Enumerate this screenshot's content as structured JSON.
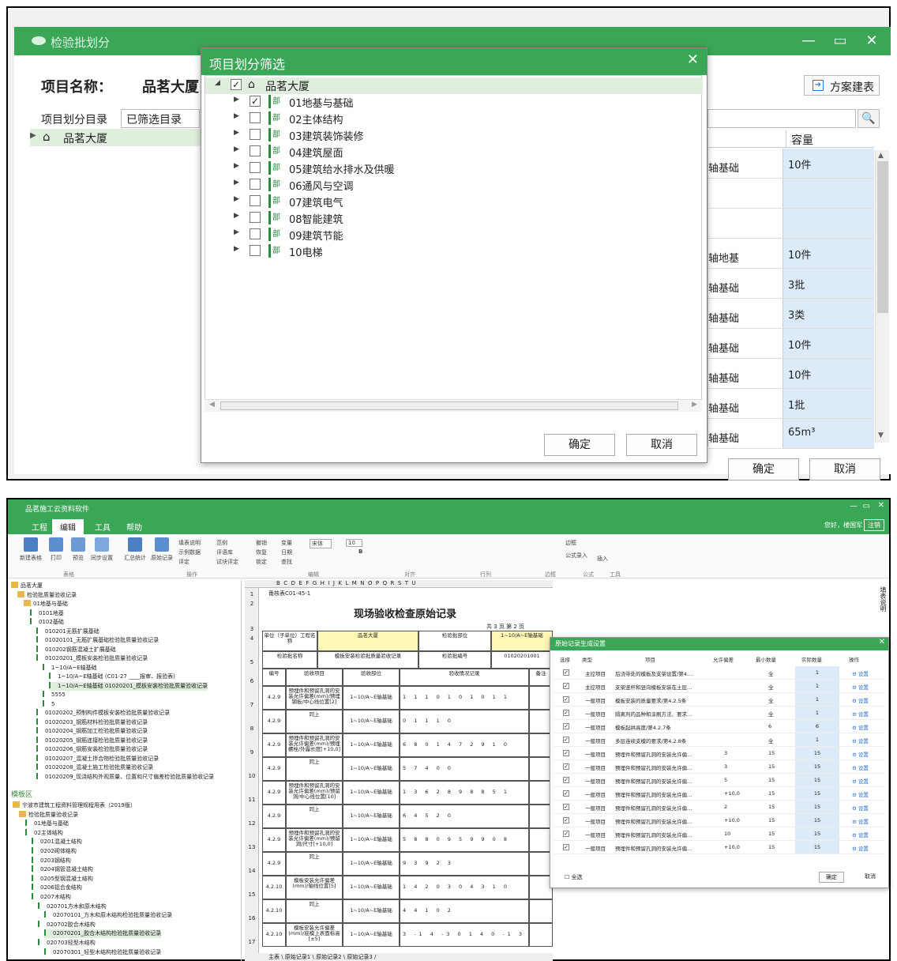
{
  "top_window": {
    "title": "检验批划分",
    "project_label": "项目名称：",
    "project_value": "品茗大厦",
    "plan_button": "方案建表",
    "dir_label": "项目划分目录",
    "dir_value": "已筛选目录",
    "tree_root": "品茗大厦",
    "grid_header": "容量",
    "grid_rows": [
      {
        "a": "轴基础",
        "b": "10件"
      },
      {
        "a": "",
        "b": ""
      },
      {
        "a": "",
        "b": ""
      },
      {
        "a": "轴地基",
        "b": "10件"
      },
      {
        "a": "轴基础",
        "b": "3批"
      },
      {
        "a": "轴基础",
        "b": "3类"
      },
      {
        "a": "轴基础",
        "b": "10件"
      },
      {
        "a": "轴基础",
        "b": "10件"
      },
      {
        "a": "轴基础",
        "b": "1批"
      },
      {
        "a": "轴基础",
        "b": "65m³"
      }
    ],
    "ok": "确定",
    "cancel": "取消"
  },
  "filter_dialog": {
    "title": "项目划分筛选",
    "root": "品茗大厦",
    "icon_text": "部",
    "items": [
      {
        "label": "01地基与基础",
        "checked": true
      },
      {
        "label": "02主体结构",
        "checked": false
      },
      {
        "label": "03建筑装饰装修",
        "checked": false
      },
      {
        "label": "04建筑屋面",
        "checked": false
      },
      {
        "label": "05建筑给水排水及供暖",
        "checked": false
      },
      {
        "label": "06通风与空调",
        "checked": false
      },
      {
        "label": "07建筑电气",
        "checked": false
      },
      {
        "label": "08智能建筑",
        "checked": false
      },
      {
        "label": "09建筑节能",
        "checked": false
      },
      {
        "label": "10电梯",
        "checked": false
      }
    ],
    "ok": "确定",
    "cancel": "取消"
  },
  "bottom_window": {
    "title": "品茗施工云资料软件",
    "menu": [
      "工程",
      "编辑",
      "工具",
      "帮助"
    ],
    "user": "您好，楼国军",
    "exit": "注销",
    "ribbon_big": [
      "新建表格",
      "打印",
      "预览",
      "同步设置",
      "汇总统计",
      "原始记录"
    ],
    "ribbon_small": [
      "填表说明",
      "范例",
      "示例数据",
      "评语库",
      "评定",
      "试块评定",
      "撤销",
      "变量",
      "恢复",
      "日期",
      "锁定",
      "查找",
      "宋体",
      "10",
      "B",
      "行列",
      "边框",
      "公式录入",
      "公式清除",
      "插入"
    ],
    "ribbon_groups": [
      "表格",
      "操作",
      "编辑",
      "对齐",
      "行列",
      "边框",
      "公式",
      "工具"
    ],
    "tree": [
      "品茗大厦",
      "检验批质量验收记录",
      "01地基与基础",
      "0101地基",
      "0102基础",
      "010201无筋扩展基础",
      "01020101_无筋扩展基础检验批质量验收记录",
      "010202钢筋混凝土扩展基础",
      "01020201_模板安装检验批质量验收记录",
      "1~10/A~E轴基础",
      "1~10/A~E轴基础 (C01-27 ____报审、报验表)",
      "1~10/A~E轴基础 01020201_模板安装检验批质量验收记录",
      "5555",
      "5",
      "01020202_预制构件模板安装检验批质量验收记录",
      "01020203_钢筋材料检验批质量验收记录",
      "01020204_钢筋加工检验批质量验收记录",
      "01020205_钢筋连接检验批质量验收记录",
      "01020206_钢筋安装检验批质量验收记录",
      "01020207_混凝土拌合物检验批质量验收记录",
      "01020208_混凝土施工检验批质量验收记录",
      "01020209_现浇结构外观质量、位置和尺寸偏差检验批质量验收记录"
    ],
    "template_label": "模板区",
    "tree2": [
      "宁波市建筑工程资料管理规程用表（2019版）",
      "检验批质量验收记录",
      "01地基与基础",
      "02主体结构",
      "0201混凝土结构",
      "0202砌体结构",
      "0203钢结构",
      "0204钢管混凝土结构",
      "0205型钢混凝土结构",
      "0206铝合金结构",
      "0207木结构",
      "020701方木和原木结构",
      "02070101_方木和原木结构检验批质量验收记录",
      "020702胶合木结构",
      "02070201_胶合木结构检验批质量验收记录",
      "020703轻型木结构",
      "02070301_轻型木结构检验批质量验收记录"
    ],
    "sheet": {
      "cols": "B  C  D  E  F  G  H  I  J  K  L  M  N  O  P  Q  R  S  T  U",
      "form_code": "甬核表C01-45-1",
      "title": "现场验收检查原始记录",
      "page_info": "共 3 页  第 2 页",
      "unit_label": "单位（子单位）工程名称",
      "unit_value": "品茗大厦",
      "part_label": "检验批部位",
      "part_value": "1~10/A~E轴基础",
      "batch_label": "检验批名称",
      "batch_value": "模板安装检验批质量验收记录",
      "batch_no_label": "检验批编号",
      "batch_no_value": "01020201001",
      "h_no": "编号",
      "h_item": "验收项目",
      "h_part": "验收部位",
      "h_check": "验收情况记录",
      "h_note": "备注",
      "rows": [
        {
          "n": "7",
          "no": "4.2.9",
          "item": "预埋件和预留孔洞的安装允许偏差(mm)/预埋钢板/中心线位置[2]",
          "part": "1~10/A~E轴基础",
          "v": "1 1 1 0 1 0 1 0 1 1"
        },
        {
          "n": "8",
          "no": "4.2.9",
          "item": "同上",
          "part": "1~10/A~E轴基础",
          "v": "0 1 1 1 0"
        },
        {
          "n": "9",
          "no": "4.2.9",
          "item": "预埋件和预留孔洞的安装允许偏差(mm)/预埋螺栓/外露长度[+10,0]",
          "part": "1~10/A~E轴基础",
          "v": "6 8 0 1 4 7 2 9 1 0"
        },
        {
          "n": "10",
          "no": "4.2.9",
          "item": "同上",
          "part": "1~10/A~E轴基础",
          "v": "5 7 4 0 0"
        },
        {
          "n": "11",
          "no": "4.2.9",
          "item": "预埋件和预留孔洞的安装允许偏差(mm)/预留洞/中心线位置[10]",
          "part": "1~10/A~E轴基础",
          "v": "1 3 6 2 8 9 8 8 5 1"
        },
        {
          "n": "12",
          "no": "4.2.9",
          "item": "同上",
          "part": "1~10/A~E轴基础",
          "v": "6 4 5 2 0"
        },
        {
          "n": "13",
          "no": "4.2.9",
          "item": "预埋件和预留孔洞的安装允许偏差(mm)/预留洞/尺寸[+10,0]",
          "part": "1~10/A~E轴基础",
          "v": "5 8 8 0 9 5 9 9 0 8"
        },
        {
          "n": "14",
          "no": "4.2.9",
          "item": "同上",
          "part": "1~10/A~E轴基础",
          "v": "9 3 9 2 3"
        },
        {
          "n": "15",
          "no": "4.2.10",
          "item": "模板安装允许偏差(mm)/轴线位置[5]",
          "part": "1~10/A~E轴基础",
          "v": "1 4 2 0 3 0 4 3 1 0"
        },
        {
          "n": "16",
          "no": "4.2.10",
          "item": "同上",
          "part": "1~10/A~E轴基础",
          "v": "4 4 1 0 2"
        },
        {
          "n": "17",
          "no": "4.2.10",
          "item": "模板安装允许偏差(mm)/底模上表面标高[±5]",
          "part": "1~10/A~E轴基础",
          "v": "3 -1 4 -3 0 1 4 0 -1 3"
        }
      ],
      "row_nums": [
        "1",
        "2",
        "3",
        "4",
        "5",
        "6"
      ],
      "tabs": "主表 \\ 原始记录1 \\ 原始记录2 \\ 原始记录3 /"
    },
    "side_notes": "填表说明",
    "orig_dialog": {
      "title": "原始记录生成设置",
      "headers": [
        "选择",
        "类型",
        "项目",
        "允许偏差",
        "最小数量",
        "实际数量",
        "操作"
      ],
      "rows": [
        {
          "t": "主控项目",
          "p": "后浇带处的模板及支架设置/第4.…",
          "d": "",
          "min": "全",
          "act": "1"
        },
        {
          "t": "主控项目",
          "p": "支架竖杆和竖向模板安装在土层…",
          "d": "",
          "min": "全",
          "act": "1"
        },
        {
          "t": "一般项目",
          "p": "模板安装的质量要求/第4.2.5条",
          "d": "",
          "min": "全",
          "act": "1"
        },
        {
          "t": "一般项目",
          "p": "隔离剂的品种和涂刷方法、要求…",
          "d": "",
          "min": "全",
          "act": "1"
        },
        {
          "t": "一般项目",
          "p": "模板起拱高度/第4.2.7条",
          "d": "",
          "min": "6",
          "act": "6"
        },
        {
          "t": "一般项目",
          "p": "多层连续支模的要求/第4.2.8条",
          "d": "",
          "min": "全",
          "act": "1"
        },
        {
          "t": "一般项目",
          "p": "预埋件和预留孔洞的安装允许偏…",
          "d": "3",
          "min": "15",
          "act": "15"
        },
        {
          "t": "一般项目",
          "p": "预埋件和预留孔洞的安装允许偏…",
          "d": "3",
          "min": "15",
          "act": "15"
        },
        {
          "t": "一般项目",
          "p": "预埋件和预留孔洞的安装允许偏…",
          "d": "5",
          "min": "15",
          "act": "15"
        },
        {
          "t": "一般项目",
          "p": "预埋件和预留孔洞的安装允许偏…",
          "d": "+10,0",
          "min": "15",
          "act": "15"
        },
        {
          "t": "一般项目",
          "p": "预埋件和预留孔洞的安装允许偏…",
          "d": "2",
          "min": "15",
          "act": "15"
        },
        {
          "t": "一般项目",
          "p": "预埋件和预留孔洞的安装允许偏…",
          "d": "+10,0",
          "min": "15",
          "act": "15"
        },
        {
          "t": "一般项目",
          "p": "预埋件和预留孔洞的安装允许偏…",
          "d": "10",
          "min": "15",
          "act": "15"
        },
        {
          "t": "一般项目",
          "p": "预埋件和预留孔洞的安装允许偏…",
          "d": "+10,0",
          "min": "15",
          "act": "15"
        }
      ],
      "op_label": "设置",
      "select_all": "全选",
      "ok": "确定",
      "cancel": "取消"
    }
  },
  "colors": {
    "brand": "#3aa757",
    "selection": "#dfeedd",
    "cell_blue": "#dcebf7",
    "cell_yellow": "#fff9b8"
  }
}
